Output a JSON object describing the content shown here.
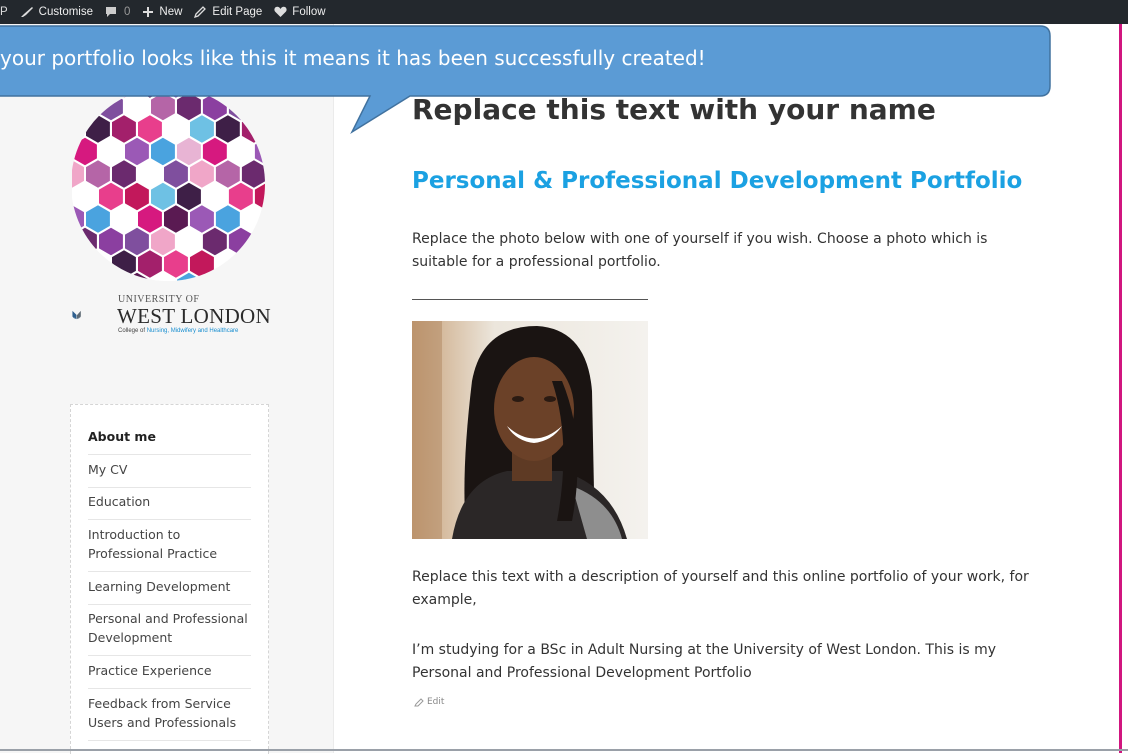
{
  "admin_bar": {
    "first_fragment": "P",
    "items": [
      {
        "label": "Customise",
        "icon": "brush-icon"
      },
      {
        "label": "0",
        "icon": "comment-icon"
      },
      {
        "label": "New",
        "icon": "plus-icon"
      },
      {
        "label": "Edit Page",
        "icon": "pencil-icon"
      },
      {
        "label": "Follow",
        "icon": "heart-icon"
      }
    ]
  },
  "callout": {
    "text": "your portfolio looks like this it means it has been successfully created!"
  },
  "sidebar": {
    "logo": {
      "university_of": "UNIVERSITY OF",
      "west_london": "WEST LONDON",
      "college_prefix": "College of ",
      "college_highlight": "Nursing, Midwifery and Healthcare"
    },
    "menu": [
      {
        "label": "About me",
        "active": true
      },
      {
        "label": "My CV"
      },
      {
        "label": "Education"
      },
      {
        "label": "Introduction to Professional Practice"
      },
      {
        "label": "Learning Development"
      },
      {
        "label": "Personal and Professional Development"
      },
      {
        "label": "Practice Experience"
      },
      {
        "label": "Feedback from Service Users and Professionals"
      }
    ]
  },
  "main": {
    "title": "Replace this text with your name",
    "subtitle": "Personal & Professional Development Portfolio",
    "para1": "Replace the photo below with one of yourself if you wish.  Choose a photo which is suitable for a professional portfolio.",
    "para2": "Replace this text with a description of yourself and this online portfolio of your work, for example,",
    "para3": "I’m studying for a BSc in Adult Nursing at the University of West London.  This is my Personal and Professional Development Portfolio",
    "edit_label": "Edit"
  },
  "colors": {
    "admin_bar": "#23282d",
    "accent_blue": "#1ba1e2",
    "callout_fill": "#5b9bd5",
    "edge_pink": "#d1157f"
  }
}
